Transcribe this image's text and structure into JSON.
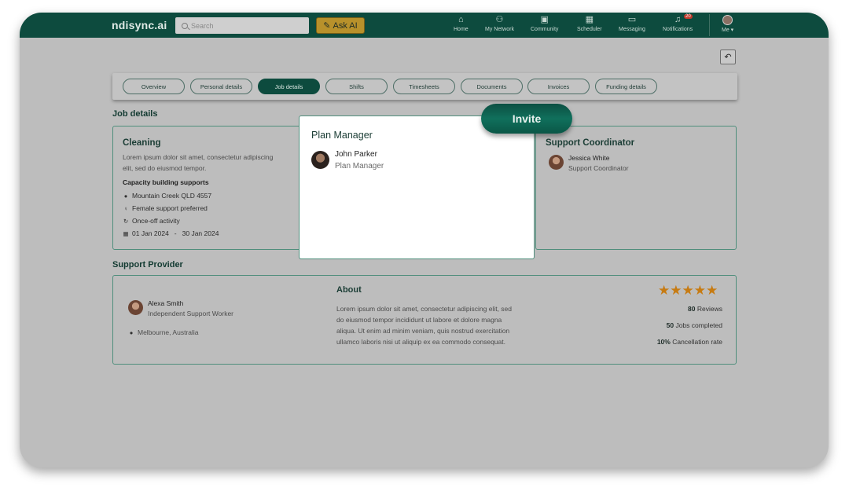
{
  "header": {
    "brand": "ndisync.ai",
    "search_placeholder": "Search",
    "ask_ai": "Ask AI",
    "nav": [
      {
        "label": "Home",
        "icon": "home-icon"
      },
      {
        "label": "My Network",
        "icon": "network-icon"
      },
      {
        "label": "Community",
        "icon": "community-icon"
      },
      {
        "label": "Scheduler",
        "icon": "calendar-icon"
      },
      {
        "label": "Messaging",
        "icon": "chat-icon"
      },
      {
        "label": "Notifications",
        "icon": "bell-icon",
        "badge": "20"
      }
    ],
    "me": "Me"
  },
  "tabs": [
    {
      "label": "Overview"
    },
    {
      "label": "Personal details"
    },
    {
      "label": "Job details",
      "active": true
    },
    {
      "label": "Shifts"
    },
    {
      "label": "Timesheets"
    },
    {
      "label": "Documents"
    },
    {
      "label": "Invoices"
    },
    {
      "label": "Funding details"
    }
  ],
  "job": {
    "section_title": "Job details",
    "title": "Cleaning",
    "desc_line1": "Lorem ipsum dolor sit amet, consectetur adipiscing",
    "desc_line2": "elit, sed do eiusmod tempor.",
    "category": "Capacity building supports",
    "location": "Mountain Creek QLD 4557",
    "preference": "Female support preferred",
    "frequency": "Once-off activity",
    "date_start": "01 Jan 2024",
    "date_sep": "-",
    "date_end": "30 Jan 2024"
  },
  "coordinator": {
    "title": "Support Coordinator",
    "name": "Jessica White",
    "role": "Support Coordinator"
  },
  "provider": {
    "section_title": "Support Provider",
    "name": "Alexa Smith",
    "role": "Independent Support Worker",
    "location": "Melbourne, Australia",
    "about_title": "About",
    "about_lines": [
      "Lorem ipsum dolor sit amet, consectetur adipiscing elit, sed",
      "do eiusmod tempor incididunt ut labore et dolore magna",
      "aliqua. Ut enim ad minim veniam, quis nostrud exercitation",
      "ullamco laboris nisi ut aliquip ex ea commodo consequat."
    ],
    "rating": 5,
    "reviews_num": "80",
    "reviews_label": "Reviews",
    "jobs_num": "50",
    "jobs_label": "Jobs completed",
    "cancel_num": "10%",
    "cancel_label": "Cancellation rate"
  },
  "modal": {
    "title": "Plan Manager",
    "name": "John Parker",
    "role": "Plan Manager",
    "invite_label": "Invite"
  },
  "colors": {
    "brand": "#0d4b3e",
    "accent_gold": "#b8912b",
    "star": "#c77b12",
    "card_border": "#4f8e7c"
  }
}
